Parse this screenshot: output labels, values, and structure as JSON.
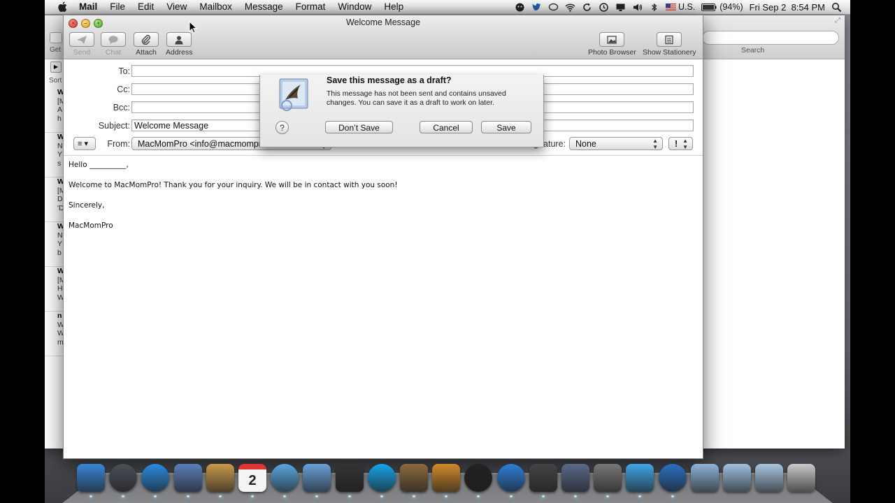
{
  "menubar": {
    "items": [
      "Mail",
      "File",
      "Edit",
      "View",
      "Mailbox",
      "Message",
      "Format",
      "Window",
      "Help"
    ],
    "status": {
      "language": "U.S.",
      "battery": "(94%)",
      "clock": "Fri Sep 2  8:54 PM"
    }
  },
  "viewer": {
    "get_label": "Get",
    "sort_label": "Sort",
    "search_label": "Search",
    "list": [
      {
        "l1": "W",
        "l2": "[M",
        "l3": "A",
        "l4": "h"
      },
      {
        "l1": "W",
        "l2": "N",
        "l3": "Y",
        "l4": "s"
      },
      {
        "l1": "W",
        "l2": "[M",
        "l3": "D",
        "l4": "'D"
      },
      {
        "l1": "W",
        "l2": "N",
        "l3": "Y",
        "l4": "b"
      },
      {
        "l1": "W",
        "l2": "[M",
        "l3": "H",
        "l4": "W"
      },
      {
        "l1": "n",
        "l2": "W",
        "l3": "W",
        "l4": "m"
      }
    ]
  },
  "compose": {
    "title": "Welcome Message",
    "toolbar": {
      "send": "Send",
      "chat": "Chat",
      "attach": "Attach",
      "address": "Address",
      "photo_browser": "Photo Browser",
      "show_stationery": "Show Stationery"
    },
    "labels": {
      "to": "To:",
      "cc": "Cc:",
      "bcc": "Bcc:",
      "subject": "Subject:",
      "from": "From:",
      "signature": "Signature:"
    },
    "values": {
      "to": "",
      "cc": "",
      "bcc": "",
      "subject": "Welcome Message",
      "from": "MacMomPro <info@macmompro.com>",
      "signature": "None",
      "priority": "!"
    },
    "body": [
      "Hello __________,",
      "Welcome to MacMomPro!  Thank you for your inquiry.  We will be in contact with you soon!",
      "Sincerely,",
      "MacMomPro"
    ]
  },
  "sheet": {
    "title": "Save this message as a draft?",
    "message": "This message has not been sent and contains unsaved changes. You can save it as a draft to work on later.",
    "help": "?",
    "dont_save": "Don’t Save",
    "cancel": "Cancel",
    "save": "Save"
  },
  "dock": {
    "apps": [
      {
        "icon": "finder-icon",
        "color": "#3a86d8"
      },
      {
        "icon": "launchpad-icon",
        "color": "#4b4f57"
      },
      {
        "icon": "app-store-icon",
        "color": "#2a8be0"
      },
      {
        "icon": "mail-icon",
        "color": "#5a7fb8"
      },
      {
        "icon": "address-book-icon",
        "color": "#c89a4a"
      },
      {
        "icon": "ical-icon",
        "color": "#e9e9e9"
      },
      {
        "icon": "safari-icon",
        "color": "#5aa7e0"
      },
      {
        "icon": "facetime-icon",
        "color": "#6aa0d8"
      },
      {
        "icon": "photo-booth-icon",
        "color": "#333"
      },
      {
        "icon": "skype-icon",
        "color": "#16a4e8"
      },
      {
        "icon": "preview-icon",
        "color": "#8a6a3e"
      },
      {
        "icon": "iphoto-icon",
        "color": "#d08a2a"
      },
      {
        "icon": "dvd-player-icon",
        "color": "#222"
      },
      {
        "icon": "itunes-icon",
        "color": "#2d7fd8"
      },
      {
        "icon": "imovie-icon",
        "color": "#444"
      },
      {
        "icon": "script-editor-icon",
        "color": "#5a6a8a"
      },
      {
        "icon": "system-preferences-icon",
        "color": "#777"
      },
      {
        "icon": "twitter-icon",
        "color": "#3fa6e6"
      },
      {
        "icon": "quicktime-icon",
        "color": "#2a6fc0"
      },
      {
        "icon": "applications-folder-icon",
        "color": "#8fb3d6"
      },
      {
        "icon": "documents-folder-icon",
        "color": "#9fc0de"
      },
      {
        "icon": "downloads-folder-icon",
        "color": "#a9c6e0"
      },
      {
        "icon": "trash-icon",
        "color": "#c9c9c9"
      }
    ],
    "calendar_day": "2"
  }
}
